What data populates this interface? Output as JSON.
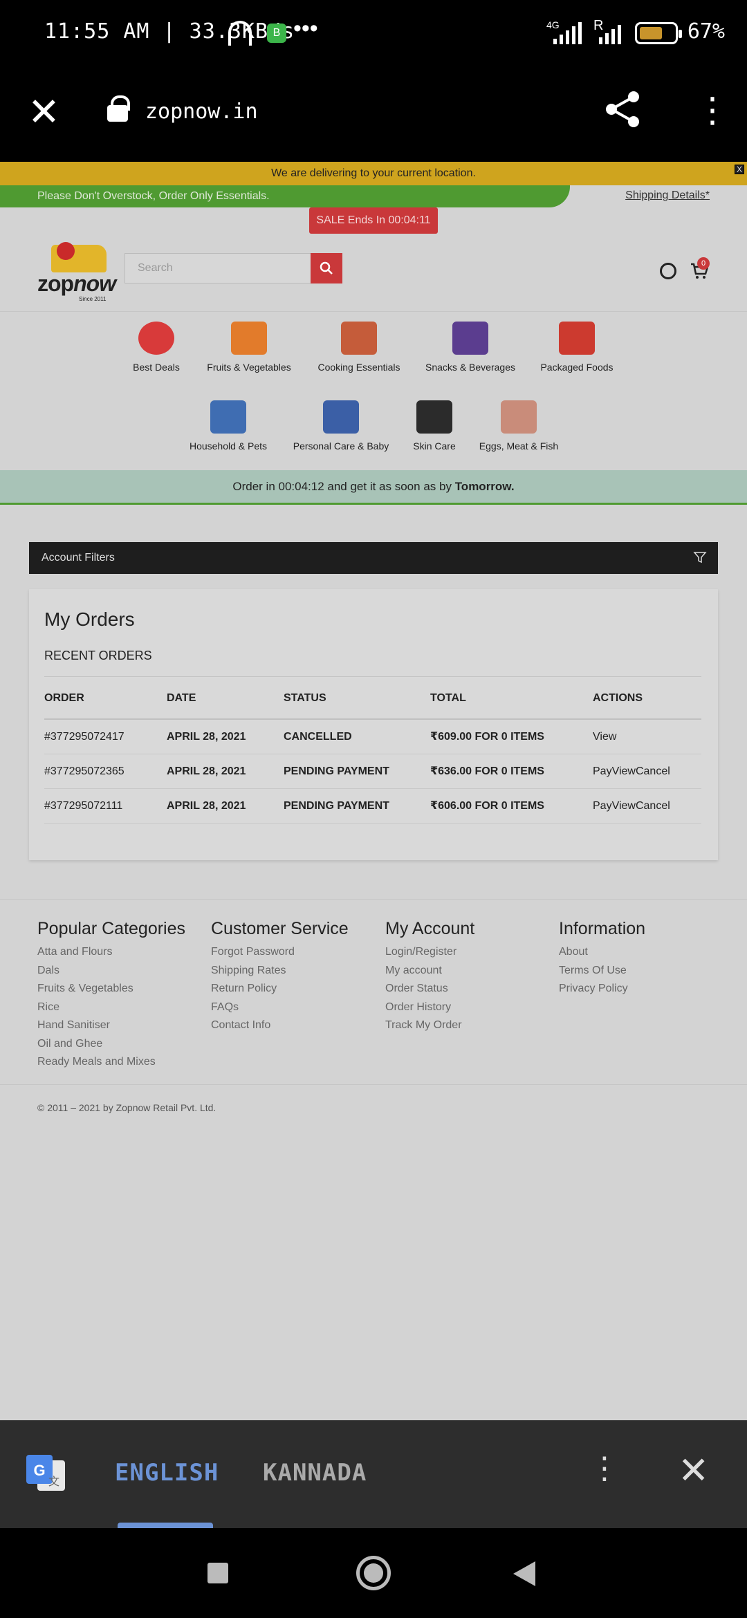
{
  "status_bar": {
    "left_text": "11:55 AM | 33.3KB/s",
    "network": "4G",
    "roaming": "R",
    "battery": "67%",
    "battery_level": 0.67
  },
  "browser": {
    "url": "zopnow.in"
  },
  "site": {
    "delivering_banner": "We are delivering to your current location.",
    "close_mark": "X",
    "notice": "Please Don't Overstock, Order Only Essentials.",
    "shipping_link": "Shipping Details*",
    "sale_button": "SALE Ends In 00:04:11",
    "logo_text": "zop",
    "logo_text_italic": "now",
    "logo_since": "Since 2011",
    "search_placeholder": "Search",
    "cart_count": "0",
    "categories": [
      {
        "label": "Best Deals",
        "color": "#d83a3a"
      },
      {
        "label": "Fruits & Vegetables",
        "color": "#e27b2b"
      },
      {
        "label": "Cooking Essentials",
        "color": "#c55c3a"
      },
      {
        "label": "Snacks & Beverages",
        "color": "#5b3d8f"
      },
      {
        "label": "Packaged Foods",
        "color": "#cc3a2f"
      },
      {
        "label": "Household & Pets",
        "color": "#3f6db2"
      },
      {
        "label": "Personal Care & Baby",
        "color": "#3b5fa6"
      },
      {
        "label": "Skin Care",
        "color": "#2b2b2b"
      },
      {
        "label": "Eggs, Meat & Fish",
        "color": "#c98c7a"
      }
    ],
    "order_banner_prefix": "Order in 00:04:12 and get it as soon as by ",
    "order_banner_bold": "Tomorrow.",
    "filters_label": "Account Filters",
    "orders": {
      "title": "My Orders",
      "subtitle": "RECENT ORDERS",
      "headers": [
        "ORDER",
        "DATE",
        "STATUS",
        "TOTAL",
        "ACTIONS"
      ],
      "rows": [
        {
          "order": "#377295072417",
          "date": "APRIL 28, 2021",
          "status": "CANCELLED",
          "total": "₹609.00 FOR 0 ITEMS",
          "actions": "View"
        },
        {
          "order": "#377295072365",
          "date": "APRIL 28, 2021",
          "status": "PENDING PAYMENT",
          "total": "₹636.00 FOR 0 ITEMS",
          "actions": "PayViewCancel"
        },
        {
          "order": "#377295072111",
          "date": "APRIL 28, 2021",
          "status": "PENDING PAYMENT",
          "total": "₹606.00 FOR 0 ITEMS",
          "actions": "PayViewCancel"
        }
      ]
    },
    "footer": {
      "columns": [
        {
          "title": "Popular Categories",
          "links": [
            "Atta and Flours",
            "Dals",
            "Fruits & Vegetables",
            "Rice",
            "Hand Sanitiser",
            "Oil and Ghee",
            "Ready Meals and Mixes"
          ]
        },
        {
          "title": "Customer Service",
          "links": [
            "Forgot Password",
            "Shipping Rates",
            "Return Policy",
            "FAQs",
            "Contact Info"
          ]
        },
        {
          "title": "My Account",
          "links": [
            "Login/Register",
            "My account",
            "Order Status",
            "Order History",
            "Track My Order"
          ]
        },
        {
          "title": "Information",
          "links": [
            "About",
            "Terms Of Use",
            "Privacy Policy"
          ]
        }
      ],
      "copyright": "© 2011 – 2021 by Zopnow Retail Pvt. Ltd."
    }
  },
  "translate_bar": {
    "lang_selected": "ENGLISH",
    "lang_other": "KANNADA"
  }
}
